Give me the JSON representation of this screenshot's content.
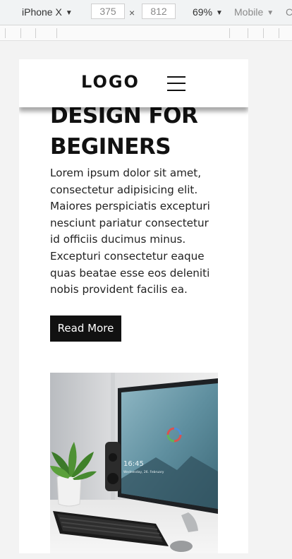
{
  "devtools": {
    "device": "iPhone X",
    "width": "375",
    "times": "×",
    "height": "812",
    "zoom": "69%",
    "mode": "Mobile",
    "more": "C",
    "caret": "▼"
  },
  "navbar": {
    "logo": "LOGO",
    "menu_icon": "hamburger-menu-icon"
  },
  "hero": {
    "headline_line1": "DESIGN FOR",
    "headline_line2": "BEGINERS",
    "paragraph_lines": [
      "Lorem ipsum dolor sit amet,",
      "consectetur adipisicing elit.",
      "Maiores perspiciatis excepturi",
      "nesciunt pariatur consectetur",
      "id officiis ducimus minus.",
      "Excepturi consectetur eaque",
      "quas beatae esse eos deleniti",
      "nobis provident facilis ea."
    ],
    "button_label": "Read More"
  },
  "photo": {
    "monitor_time": "16:45",
    "monitor_date": "Wednesday, 26. February"
  },
  "colors": {
    "text": "#111111",
    "button_bg": "#111111",
    "button_text": "#ffffff",
    "page_bg": "#ffffff"
  }
}
